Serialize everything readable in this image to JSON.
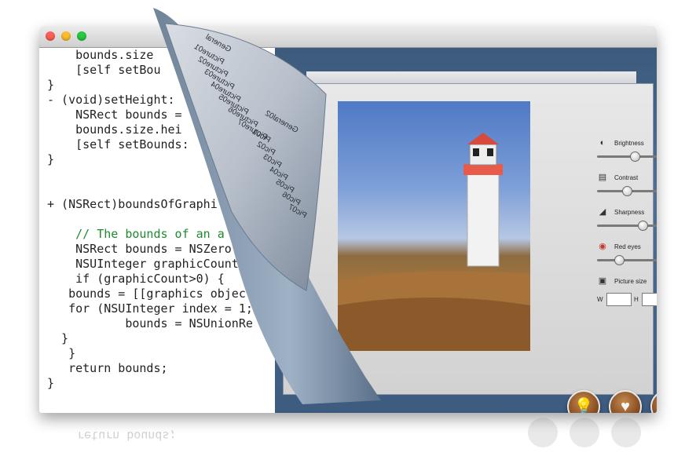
{
  "window": {
    "traffic_lights": [
      {
        "name": "close",
        "color": "#ff5f57"
      },
      {
        "name": "minimize",
        "color": "#ffbd2e"
      },
      {
        "name": "zoom",
        "color": "#28c940"
      }
    ]
  },
  "code": {
    "lines": [
      "    bounds.size",
      "    [self setBou",
      "}",
      "- (void)setHeight:",
      "    NSRect bounds =",
      "    bounds.size.hei",
      "    [self setBounds:",
      "}",
      "",
      "+ (NSRect)boundsOfGraphi",
      "",
      "    // The bounds of an a",
      "    NSRect bounds = NSZero",
      "    NSUInteger graphicCount",
      "    if (graphicCount>0) {",
      "   bounds = [[graphics object",
      "   for (NSUInteger index = 1;",
      "           bounds = NSUnionRe",
      "  }",
      "   }",
      "   return bounds;",
      "}"
    ],
    "reflection_text": "return bounds;"
  },
  "page_menu": {
    "items": [
      "General",
      "Picture01",
      "Picture02",
      "Picture03",
      "Picture04",
      "Picture05",
      "Picture06",
      "Picture07",
      "General02",
      "Pic01",
      "Pic02",
      "Pic03",
      "Pic04",
      "Pic05",
      "Pic06",
      "Pic07"
    ]
  },
  "controls": {
    "brightness": {
      "label": "Brightness",
      "value": 0.5
    },
    "contrast": {
      "label": "Contrast",
      "value": 0.4
    },
    "sharpness": {
      "label": "Sharpness",
      "value": 0.6
    },
    "red_eyes": {
      "label": "Red eyes",
      "value": 0.3
    },
    "picture_size": {
      "label": "Picture size",
      "w_label": "W",
      "h_label": "H",
      "w_value": "",
      "h_value": ""
    }
  },
  "buttons": {
    "idea": {
      "icon": "lightbulb-icon"
    },
    "favorite": {
      "icon": "heart-icon"
    },
    "mail": {
      "icon": "envelope-icon"
    }
  },
  "colors": {
    "app_blue": "#4a6a8f",
    "button_brown": "#8a4f22"
  }
}
